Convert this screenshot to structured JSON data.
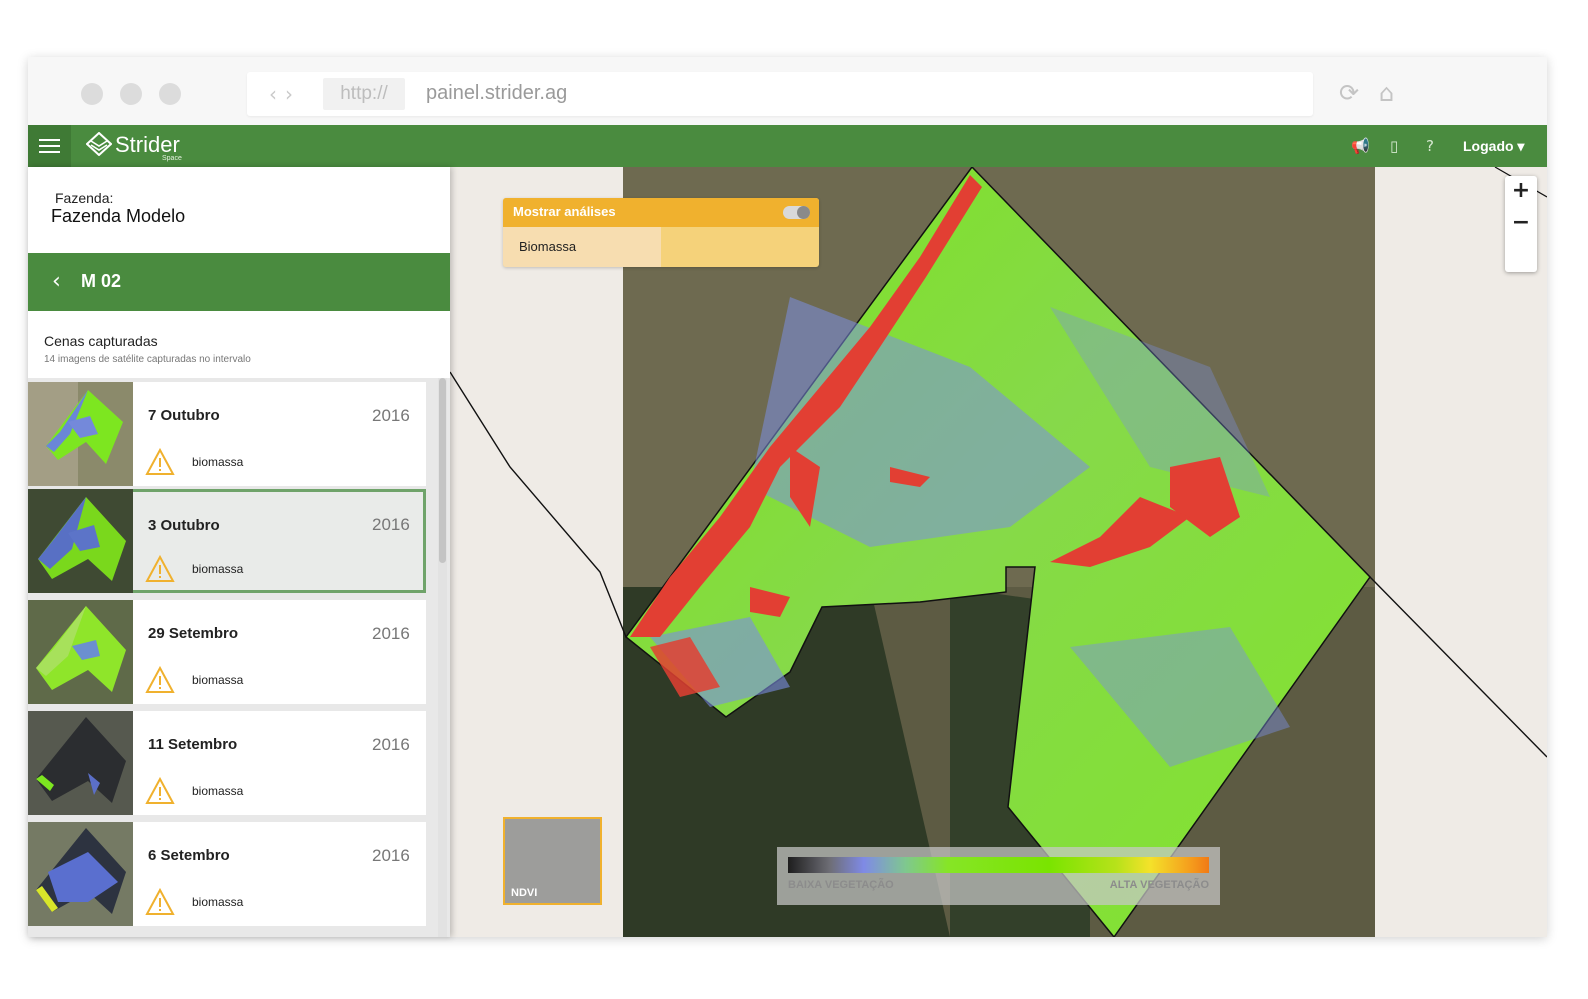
{
  "browser": {
    "protocol": "http://",
    "url": "painel.strider.ag",
    "icons": [
      "back-arrow-icon",
      "forward-arrow-icon",
      "reload-icon",
      "home-icon"
    ]
  },
  "app": {
    "brand": "Strider",
    "brand_sub": "Space",
    "user_menu": "Logado ▾",
    "icons": [
      "hamburger-menu-icon",
      "megaphone-icon",
      "book-icon",
      "help-icon"
    ],
    "colors": {
      "primary": "#4a8b3f",
      "accent": "#f0b12e"
    }
  },
  "sidebar": {
    "farm_label": "Fazenda:",
    "farm_name": "Fazenda Modelo",
    "section_title": "M 02",
    "scenes_title": "Cenas capturadas",
    "scenes_subtitle": "14 imagens de satélite capturadas no intervalo",
    "scenes": [
      {
        "date": "7 Outubro",
        "year": "2016",
        "tag": "biomassa",
        "selected": false
      },
      {
        "date": "3 Outubro",
        "year": "2016",
        "tag": "biomassa",
        "selected": true
      },
      {
        "date": "29 Setembro",
        "year": "2016",
        "tag": "biomassa",
        "selected": false
      },
      {
        "date": "11 Setembro",
        "year": "2016",
        "tag": "biomassa",
        "selected": false
      },
      {
        "date": "6 Setembro",
        "year": "2016",
        "tag": "biomassa",
        "selected": false
      }
    ]
  },
  "map": {
    "analysis_panel": {
      "title": "Mostrar análises",
      "toggle_on": true,
      "option": "Biomassa"
    },
    "zoom_in": "+",
    "zoom_out": "−",
    "layer": "NDVI",
    "legend": {
      "low": "BAIXA VEGETAÇÃO",
      "high": "ALTA VEGETAÇÃO"
    }
  }
}
